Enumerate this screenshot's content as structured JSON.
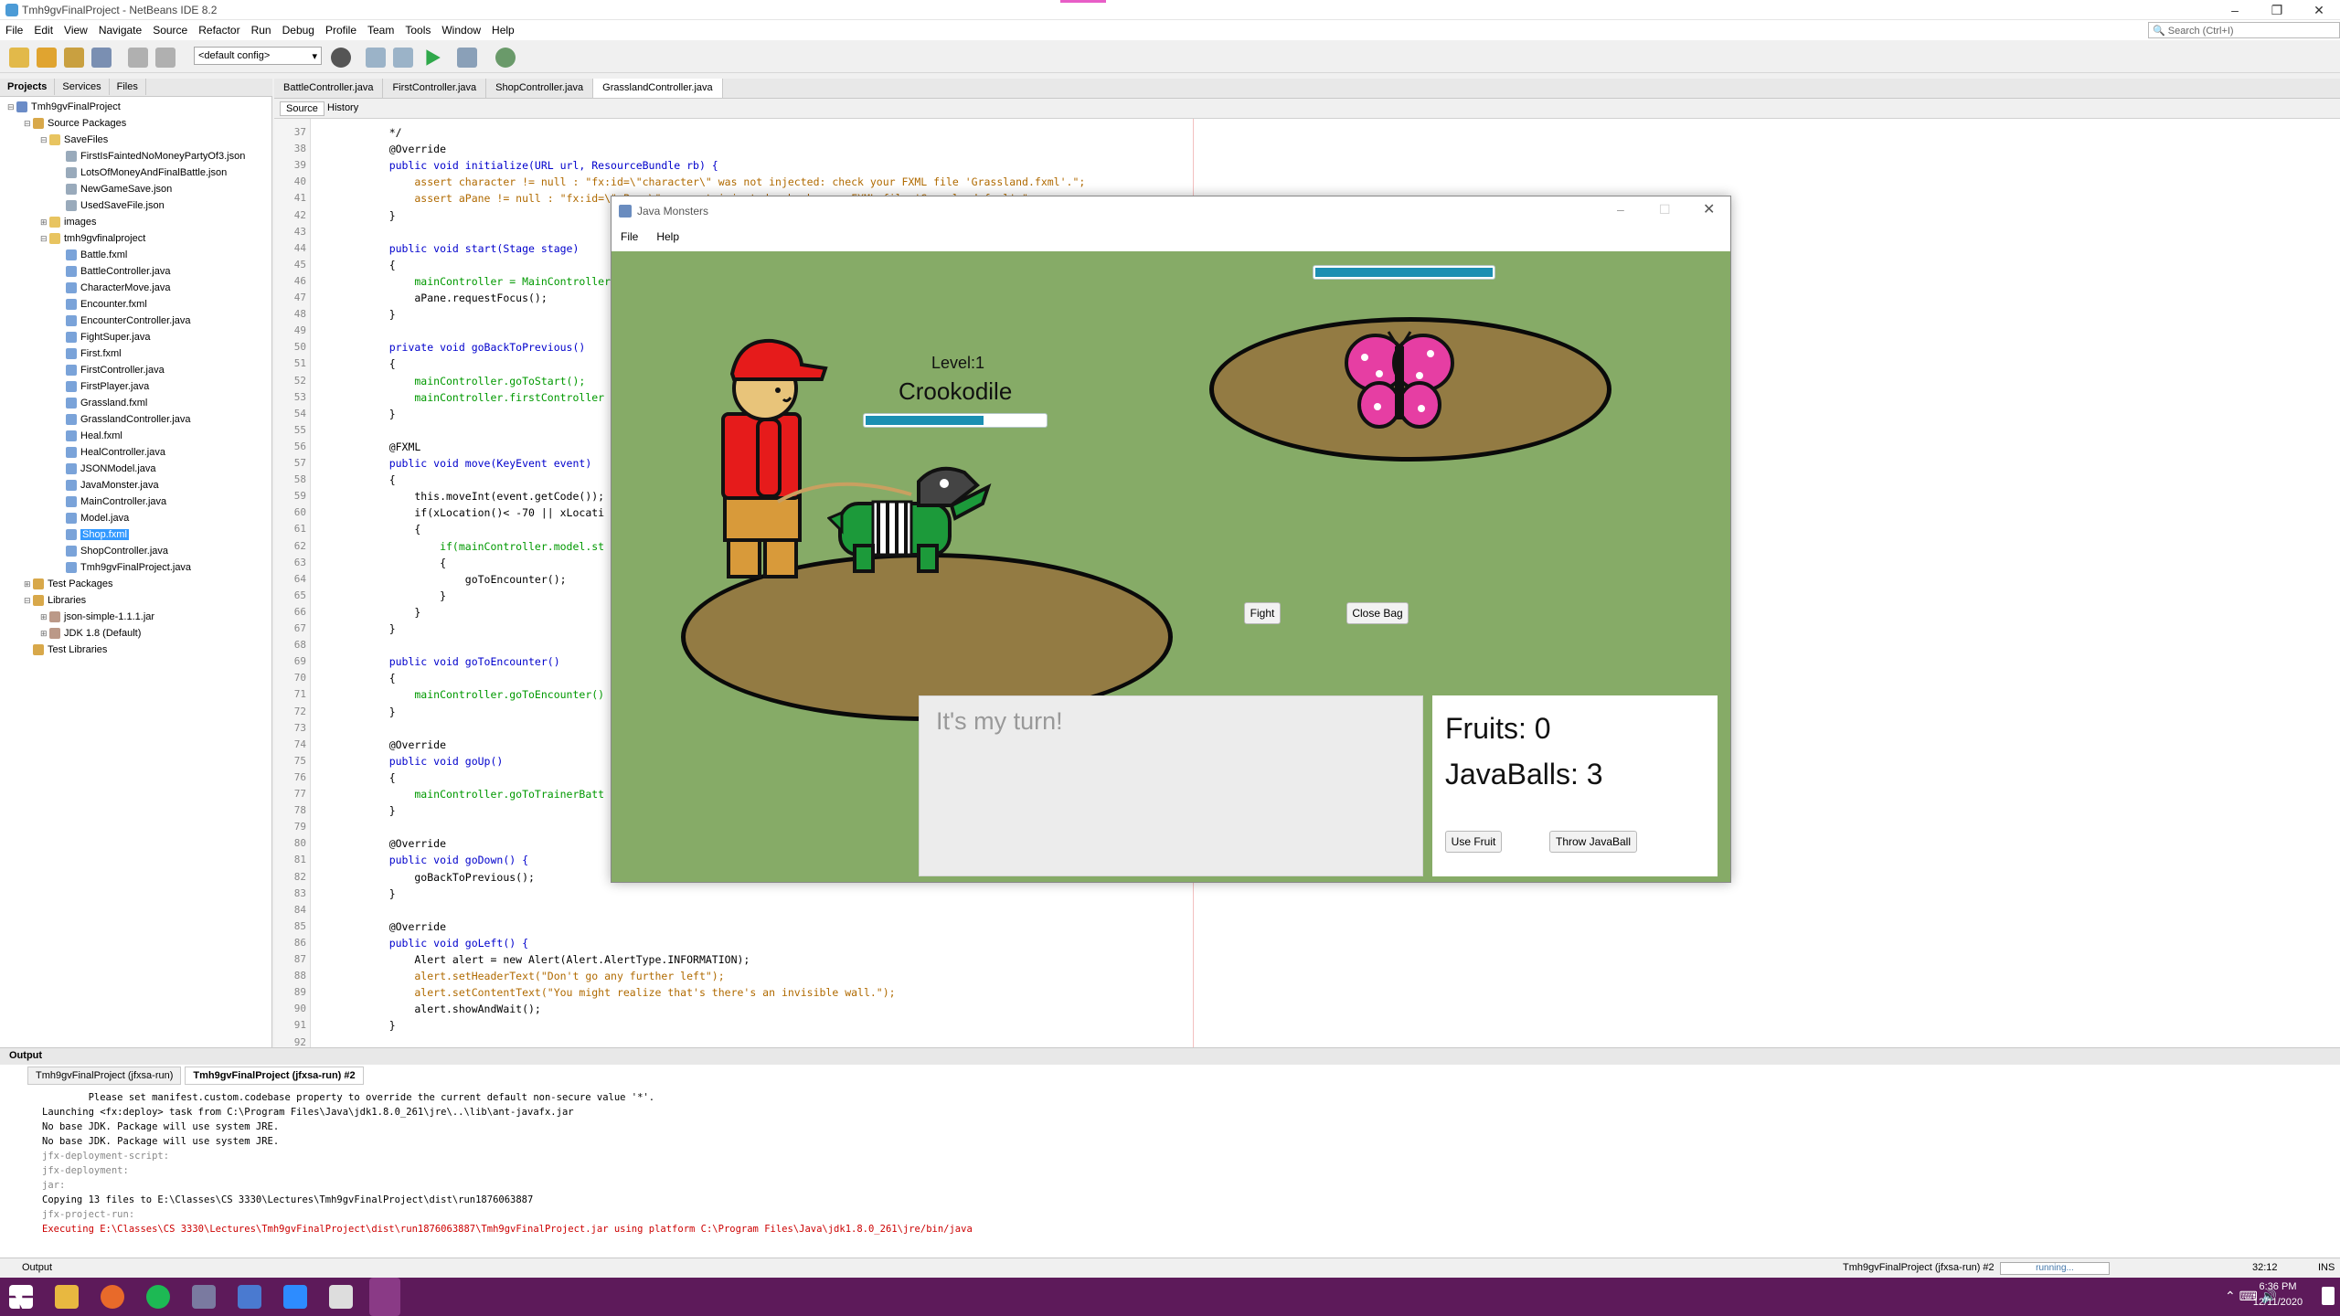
{
  "ide": {
    "title": "Tmh9gvFinalProject - NetBeans IDE 8.2",
    "menu": [
      "File",
      "Edit",
      "View",
      "Navigate",
      "Source",
      "Refactor",
      "Run",
      "Debug",
      "Profile",
      "Team",
      "Tools",
      "Window",
      "Help"
    ],
    "search_placeholder": "Search (Ctrl+I)",
    "config": "<default config>"
  },
  "left_panel": {
    "tabs": [
      "Projects",
      "Services",
      "Files"
    ],
    "tree": [
      {
        "label": "Tmh9gvFinalProject",
        "depth": 0,
        "color": "#6b8cc7"
      },
      {
        "label": "Source Packages",
        "depth": 1,
        "color": "#d8a84a"
      },
      {
        "label": "SaveFiles",
        "depth": 2,
        "color": "#e8c460"
      },
      {
        "label": "FirstIsFaintedNoMoneyPartyOf3.json",
        "depth": 3,
        "color": "#9ab"
      },
      {
        "label": "LotsOfMoneyAndFinalBattle.json",
        "depth": 3,
        "color": "#9ab"
      },
      {
        "label": "NewGameSave.json",
        "depth": 3,
        "color": "#9ab"
      },
      {
        "label": "UsedSaveFile.json",
        "depth": 3,
        "color": "#9ab"
      },
      {
        "label": "images",
        "depth": 2,
        "color": "#e8c460"
      },
      {
        "label": "tmh9gvfinalproject",
        "depth": 2,
        "color": "#e8c460"
      },
      {
        "label": "Battle.fxml",
        "depth": 3,
        "color": "#7aa3d9"
      },
      {
        "label": "BattleController.java",
        "depth": 3,
        "color": "#7aa3d9"
      },
      {
        "label": "CharacterMove.java",
        "depth": 3,
        "color": "#7aa3d9"
      },
      {
        "label": "Encounter.fxml",
        "depth": 3,
        "color": "#7aa3d9"
      },
      {
        "label": "EncounterController.java",
        "depth": 3,
        "color": "#7aa3d9"
      },
      {
        "label": "FightSuper.java",
        "depth": 3,
        "color": "#7aa3d9"
      },
      {
        "label": "First.fxml",
        "depth": 3,
        "color": "#7aa3d9"
      },
      {
        "label": "FirstController.java",
        "depth": 3,
        "color": "#7aa3d9"
      },
      {
        "label": "FirstPlayer.java",
        "depth": 3,
        "color": "#7aa3d9"
      },
      {
        "label": "Grassland.fxml",
        "depth": 3,
        "color": "#7aa3d9"
      },
      {
        "label": "GrasslandController.java",
        "depth": 3,
        "color": "#7aa3d9"
      },
      {
        "label": "Heal.fxml",
        "depth": 3,
        "color": "#7aa3d9"
      },
      {
        "label": "HealController.java",
        "depth": 3,
        "color": "#7aa3d9"
      },
      {
        "label": "JSONModel.java",
        "depth": 3,
        "color": "#7aa3d9"
      },
      {
        "label": "JavaMonster.java",
        "depth": 3,
        "color": "#7aa3d9"
      },
      {
        "label": "MainController.java",
        "depth": 3,
        "color": "#7aa3d9"
      },
      {
        "label": "Model.java",
        "depth": 3,
        "color": "#7aa3d9"
      },
      {
        "label": "Shop.fxml",
        "depth": 3,
        "color": "#7aa3d9",
        "selected": true
      },
      {
        "label": "ShopController.java",
        "depth": 3,
        "color": "#7aa3d9"
      },
      {
        "label": "Tmh9gvFinalProject.java",
        "depth": 3,
        "color": "#7aa3d9"
      },
      {
        "label": "Test Packages",
        "depth": 1,
        "color": "#d8a84a"
      },
      {
        "label": "Libraries",
        "depth": 1,
        "color": "#d8a84a"
      },
      {
        "label": "json-simple-1.1.1.jar",
        "depth": 2,
        "color": "#b98"
      },
      {
        "label": "JDK 1.8 (Default)",
        "depth": 2,
        "color": "#b98"
      },
      {
        "label": "Test Libraries",
        "depth": 1,
        "color": "#d8a84a"
      }
    ]
  },
  "editor": {
    "tabs": [
      "BattleController.java",
      "FirstController.java",
      "ShopController.java",
      "GrasslandController.java"
    ],
    "active_tab": 3,
    "subtabs": [
      "Source",
      "History"
    ],
    "lines": [
      {
        "n": "37",
        "t": "    */"
      },
      {
        "n": "38",
        "t": "    @Override"
      },
      {
        "n": "39",
        "t": "    public void initialize(URL url, ResourceBundle rb) {"
      },
      {
        "n": "40",
        "t": "        assert character != null : \"fx:id=\\\"character\\\" was not injected: check your FXML file 'Grassland.fxml'.\";"
      },
      {
        "n": "41",
        "t": "        assert aPane != null : \"fx:id=\\\"aPane\\\" was not injected: check your FXML file 'Grassland.fxml'.\";"
      },
      {
        "n": "42",
        "t": "    }"
      },
      {
        "n": "43",
        "t": ""
      },
      {
        "n": "44",
        "t": "    public void start(Stage stage)"
      },
      {
        "n": "45",
        "t": "    {"
      },
      {
        "n": "46",
        "t": "        mainController = MainController"
      },
      {
        "n": "47",
        "t": "        aPane.requestFocus();"
      },
      {
        "n": "48",
        "t": "    }"
      },
      {
        "n": "49",
        "t": ""
      },
      {
        "n": "50",
        "t": "    private void goBackToPrevious()"
      },
      {
        "n": "51",
        "t": "    {"
      },
      {
        "n": "52",
        "t": "        mainController.goToStart();"
      },
      {
        "n": "53",
        "t": "        mainController.firstController"
      },
      {
        "n": "54",
        "t": "    }"
      },
      {
        "n": "55",
        "t": ""
      },
      {
        "n": "56",
        "t": "    @FXML"
      },
      {
        "n": "57",
        "t": "    public void move(KeyEvent event)"
      },
      {
        "n": "58",
        "t": "    {"
      },
      {
        "n": "59",
        "t": "        this.moveInt(event.getCode());"
      },
      {
        "n": "60",
        "t": "        if(xLocation()< -70 || xLocati"
      },
      {
        "n": "61",
        "t": "        {"
      },
      {
        "n": "62",
        "t": "            if(mainController.model.st"
      },
      {
        "n": "63",
        "t": "            {"
      },
      {
        "n": "64",
        "t": "                goToEncounter();"
      },
      {
        "n": "65",
        "t": "            }"
      },
      {
        "n": "66",
        "t": "        }"
      },
      {
        "n": "67",
        "t": "    }"
      },
      {
        "n": "68",
        "t": ""
      },
      {
        "n": "69",
        "t": "    public void goToEncounter()"
      },
      {
        "n": "70",
        "t": "    {"
      },
      {
        "n": "71",
        "t": "        mainController.goToEncounter()"
      },
      {
        "n": "72",
        "t": "    }"
      },
      {
        "n": "73",
        "t": ""
      },
      {
        "n": "74",
        "t": "    @Override"
      },
      {
        "n": "75",
        "t": "    public void goUp()"
      },
      {
        "n": "76",
        "t": "    {"
      },
      {
        "n": "77",
        "t": "        mainController.goToTrainerBatt"
      },
      {
        "n": "78",
        "t": "    }"
      },
      {
        "n": "79",
        "t": ""
      },
      {
        "n": "80",
        "t": "    @Override"
      },
      {
        "n": "81",
        "t": "    public void goDown() {"
      },
      {
        "n": "82",
        "t": "        goBackToPrevious();"
      },
      {
        "n": "83",
        "t": "    }"
      },
      {
        "n": "84",
        "t": ""
      },
      {
        "n": "85",
        "t": "    @Override"
      },
      {
        "n": "86",
        "t": "    public void goLeft() {"
      },
      {
        "n": "87",
        "t": "        Alert alert = new Alert(Alert.AlertType.INFORMATION);"
      },
      {
        "n": "88",
        "t": "        alert.setHeaderText(\"Don't go any further left\");"
      },
      {
        "n": "89",
        "t": "        alert.setContentText(\"You might realize that's there's an invisible wall.\");"
      },
      {
        "n": "90",
        "t": "        alert.showAndWait();"
      },
      {
        "n": "91",
        "t": "    }"
      },
      {
        "n": "92",
        "t": ""
      }
    ]
  },
  "output": {
    "header": "Output",
    "tabs": [
      "Tmh9gvFinalProject (jfxsa-run)",
      "Tmh9gvFinalProject (jfxsa-run) #2"
    ],
    "lines": [
      {
        "t": "        Please set manifest.custom.codebase property to override the current default non-secure value '*'.",
        "c": ""
      },
      {
        "t": "Launching <fx:deploy> task from C:\\Program Files\\Java\\jdk1.8.0_261\\jre\\..\\lib\\ant-javafx.jar",
        "c": ""
      },
      {
        "t": "No base JDK. Package will use system JRE.",
        "c": ""
      },
      {
        "t": "No base JDK. Package will use system JRE.",
        "c": ""
      },
      {
        "t": "jfx-deployment-script:",
        "c": "grey"
      },
      {
        "t": "jfx-deployment:",
        "c": "grey"
      },
      {
        "t": "jar:",
        "c": "grey"
      },
      {
        "t": "Copying 13 files to E:\\Classes\\CS 3330\\Lectures\\Tmh9gvFinalProject\\dist\\run1876063887",
        "c": ""
      },
      {
        "t": "jfx-project-run:",
        "c": "grey"
      },
      {
        "t": "Executing E:\\Classes\\CS 3330\\Lectures\\Tmh9gvFinalProject\\dist\\run1876063887\\Tmh9gvFinalProject.jar using platform C:\\Program Files\\Java\\jdk1.8.0_261\\jre/bin/java",
        "c": "red"
      }
    ]
  },
  "status": {
    "process": "Tmh9gvFinalProject (jfxsa-run) #2",
    "progress": "running...",
    "position": "32:12",
    "mode": "INS"
  },
  "taskbar": {
    "time": "6:36 PM",
    "date": "12/11/2020"
  },
  "game": {
    "title": "Java Monsters",
    "menu": [
      "File",
      "Help"
    ],
    "enemy_hp_fraction": 1.0,
    "player_level": "Level:1",
    "player_monster": "Crookodile",
    "player_hp_fraction": 0.66,
    "fight_label": "Fight",
    "close_bag_label": "Close Bag",
    "message": "It's my turn!",
    "fruits": "Fruits: 0",
    "javaballs": "JavaBalls: 3",
    "use_fruit_label": "Use Fruit",
    "throw_label": "Throw JavaBall",
    "colors": {
      "grass": "#86ab67",
      "dirt": "#937b43",
      "hp": "#1b8fb2"
    }
  }
}
